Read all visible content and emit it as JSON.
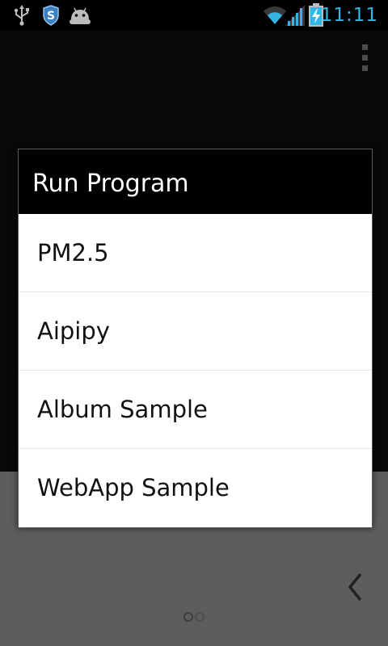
{
  "status_bar": {
    "time": "11:11",
    "left_icons": [
      "usb-icon",
      "shield-s-icon",
      "android-icon"
    ],
    "right_icons": [
      "wifi-icon",
      "signal-icon",
      "battery-charging-icon"
    ],
    "clock_color": "#33b5e5"
  },
  "dialog": {
    "title": "Run Program",
    "items": [
      {
        "label": "PM2.5"
      },
      {
        "label": "Aipipy"
      },
      {
        "label": "Album Sample"
      },
      {
        "label": "WebApp Sample"
      }
    ]
  },
  "app": {
    "overflow_icon": "overflow-menu-icon",
    "back_icon": "chevron-left-icon",
    "page_indicator": {
      "count": 2,
      "active": 0
    }
  }
}
